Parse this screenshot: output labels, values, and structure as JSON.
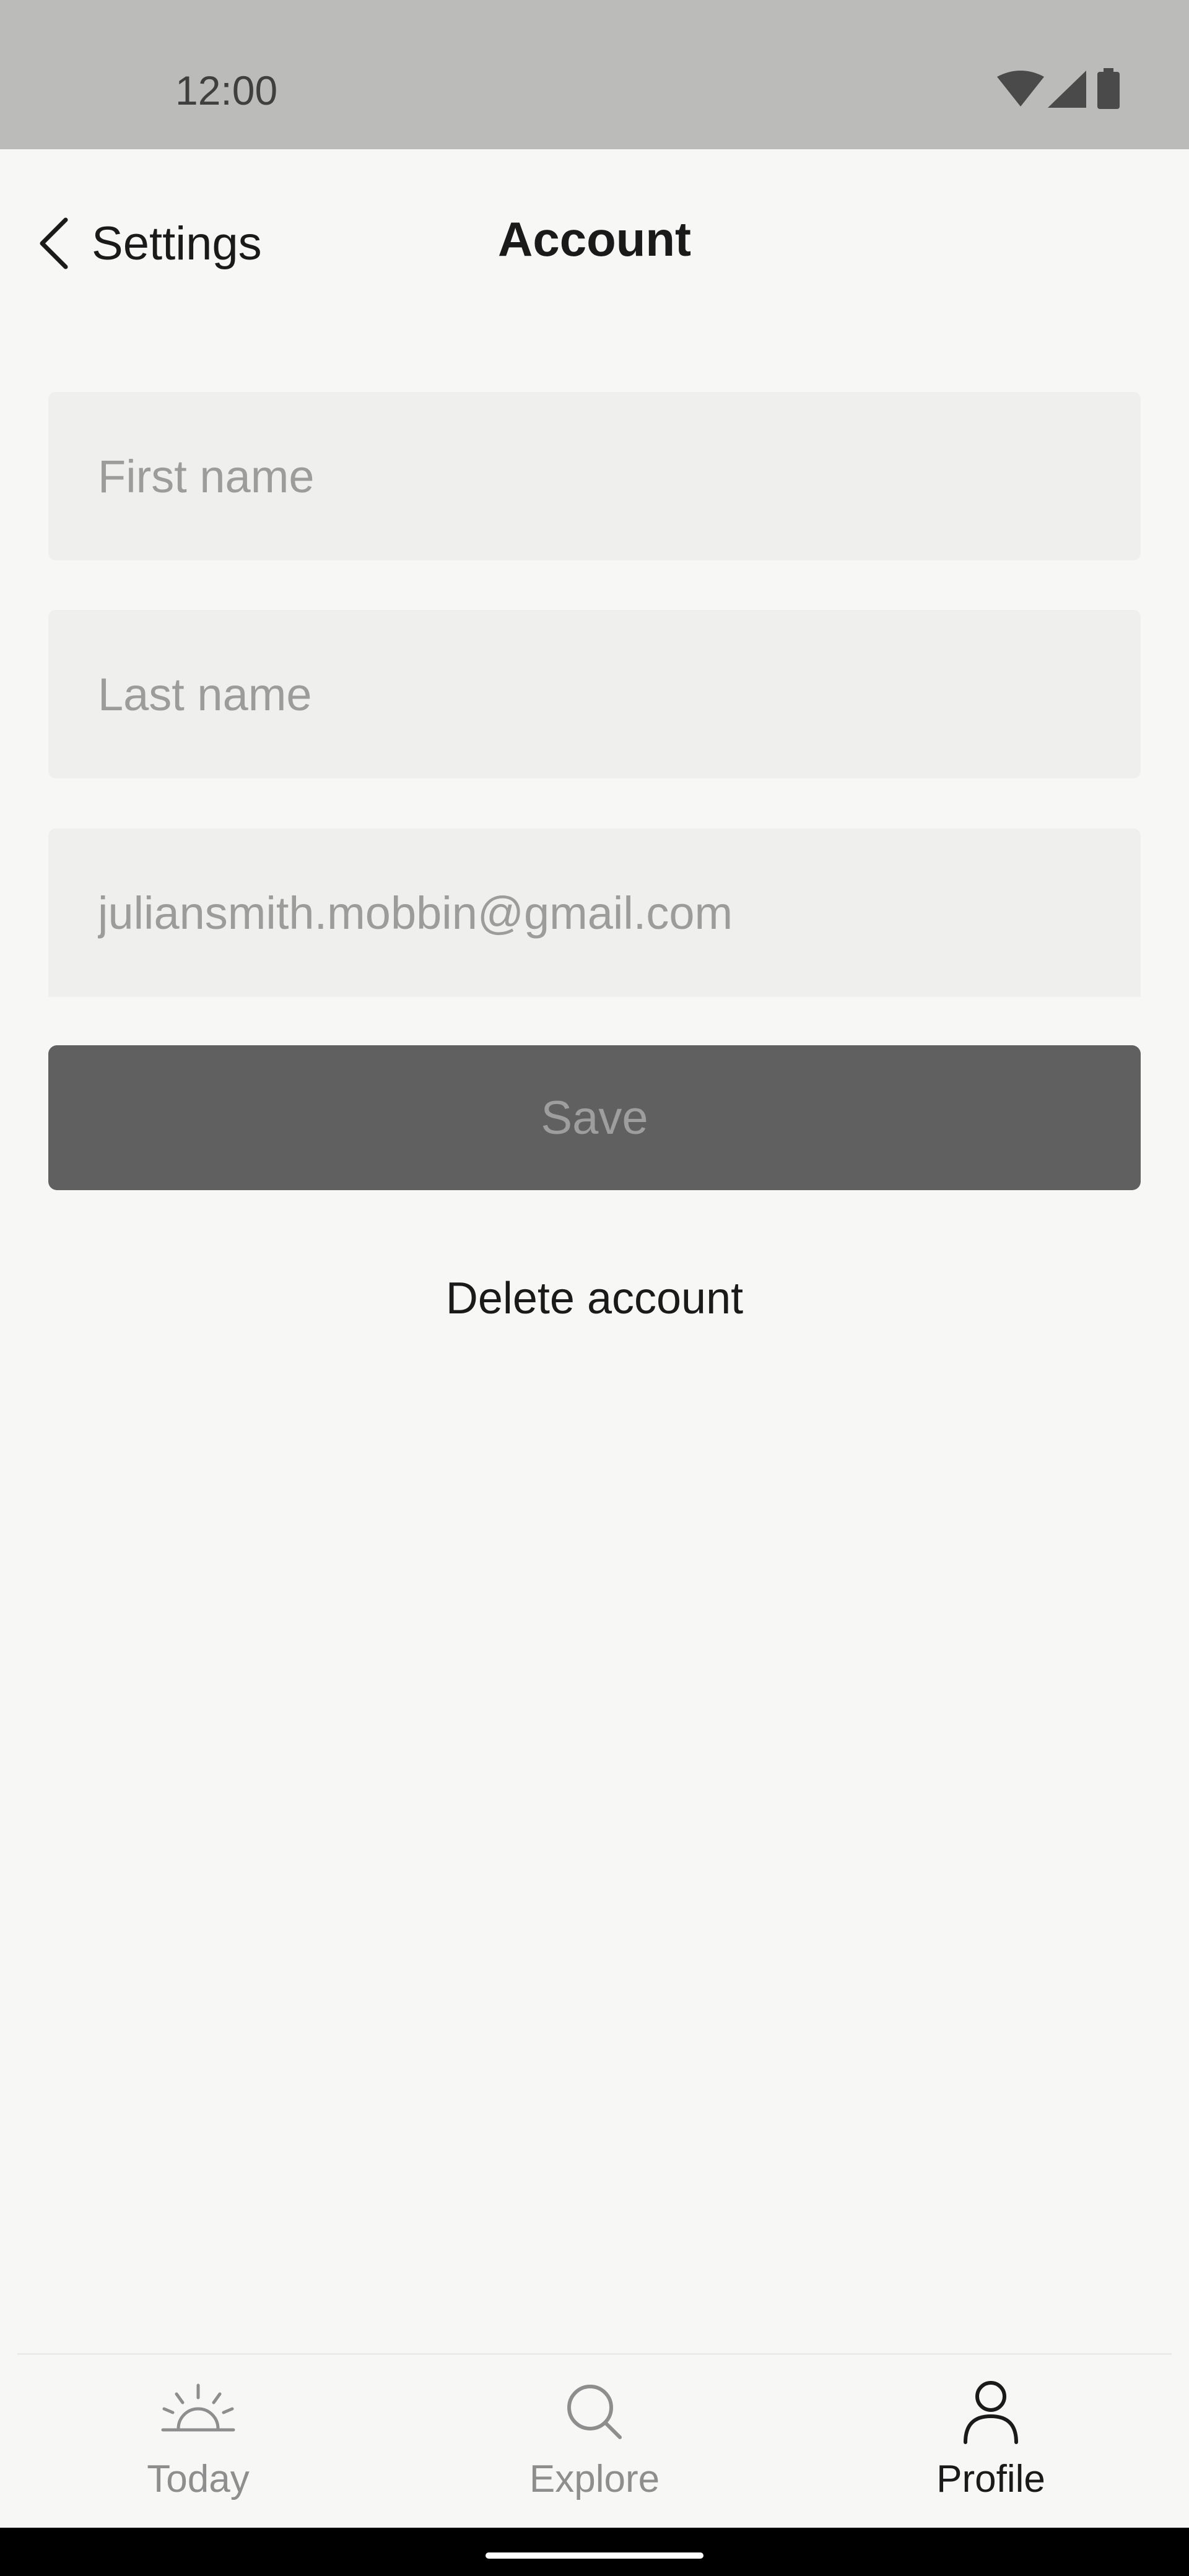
{
  "status_bar": {
    "time": "12:00",
    "icons": [
      "wifi-icon",
      "cellular-signal-icon",
      "battery-icon"
    ]
  },
  "header": {
    "back_label": "Settings",
    "title": "Account"
  },
  "form": {
    "first_name": {
      "value": "",
      "placeholder": "First name"
    },
    "last_name": {
      "value": "",
      "placeholder": "Last name"
    },
    "email": {
      "value": "juliansmith.mobbin@gmail.com",
      "placeholder": ""
    }
  },
  "actions": {
    "save_label": "Save",
    "delete_label": "Delete account"
  },
  "bottom_nav": {
    "items": [
      {
        "label": "Today",
        "icon": "sunrise-icon",
        "active": false
      },
      {
        "label": "Explore",
        "icon": "search-icon",
        "active": false
      },
      {
        "label": "Profile",
        "icon": "person-icon",
        "active": true
      }
    ]
  },
  "colors": {
    "background": "#f7f7f5",
    "status_bar": "#bbbbb9",
    "field_background": "#efefed",
    "save_button": "#606060",
    "text_primary": "#1a1a1a",
    "text_muted": "#8e8e8e"
  }
}
